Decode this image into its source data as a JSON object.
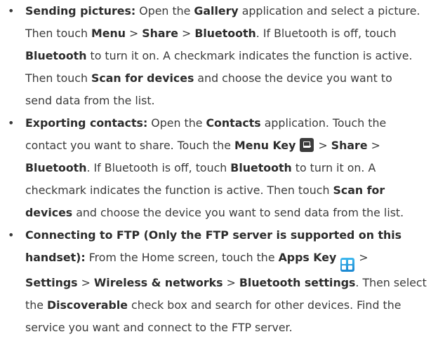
{
  "items": [
    {
      "lines": [
        [
          {
            "b": "Sending pictures:"
          },
          {
            "t": " Open the "
          },
          {
            "b": "Gallery"
          },
          {
            "t": " application and select a picture."
          }
        ],
        [
          {
            "t": "Then touch "
          },
          {
            "b": "Menu"
          },
          {
            "t": " > "
          },
          {
            "b": "Share"
          },
          {
            "t": " > "
          },
          {
            "b": "Bluetooth"
          },
          {
            "t": ". If Bluetooth is off, touch"
          }
        ],
        [
          {
            "b": "Bluetooth"
          },
          {
            "t": " to turn it on. A checkmark indicates the function is active."
          }
        ],
        [
          {
            "t": "Then touch "
          },
          {
            "b": "Scan for devices"
          },
          {
            "t": " and choose the device you want to"
          }
        ],
        [
          {
            "t": "send data from the list."
          }
        ]
      ]
    },
    {
      "lines": [
        [
          {
            "b": "Exporting contacts:"
          },
          {
            "t": " Open the "
          },
          {
            "b": "Contacts"
          },
          {
            "t": " application. Touch the"
          }
        ],
        [
          {
            "t": "contact you want to share. Touch the "
          },
          {
            "b": "Menu Key"
          },
          {
            "t": " "
          },
          {
            "icon": "menu-key-icon"
          },
          {
            "t": " > "
          },
          {
            "b": "Share"
          },
          {
            "t": " >"
          }
        ],
        [
          {
            "b": "Bluetooth"
          },
          {
            "t": ". If Bluetooth is off, touch "
          },
          {
            "b": "Bluetooth"
          },
          {
            "t": " to turn it on. A"
          }
        ],
        [
          {
            "t": "checkmark indicates the function is active. Then touch "
          },
          {
            "b": "Scan for"
          }
        ],
        [
          {
            "b": "devices"
          },
          {
            "t": " and choose the device you want to send data from the list."
          }
        ]
      ]
    },
    {
      "lines": [
        [
          {
            "b": "Connecting to FTP (Only the FTP server is supported on this"
          }
        ],
        [
          {
            "b": "handset):"
          },
          {
            "t": " From the Home screen, touch the "
          },
          {
            "b": "Apps Key"
          },
          {
            "t": " "
          },
          {
            "icon": "apps-key-icon"
          },
          {
            "t": " >"
          }
        ],
        [
          {
            "b": "Settings"
          },
          {
            "t": " > "
          },
          {
            "b": "Wireless & networks"
          },
          {
            "t": " > "
          },
          {
            "b": "Bluetooth settings"
          },
          {
            "t": ". Then select"
          }
        ],
        [
          {
            "t": "the "
          },
          {
            "b": "Discoverable"
          },
          {
            "t": " check box and search for other devices. Find the"
          }
        ],
        [
          {
            "t": "service you want and connect to the FTP server."
          }
        ]
      ]
    }
  ],
  "bullet_char": "•",
  "colors": {
    "text": "#3a3a3a",
    "bold": "#2c2c2c",
    "apps_key": "#1a86d0",
    "menu_key": "#3c3c3c"
  }
}
